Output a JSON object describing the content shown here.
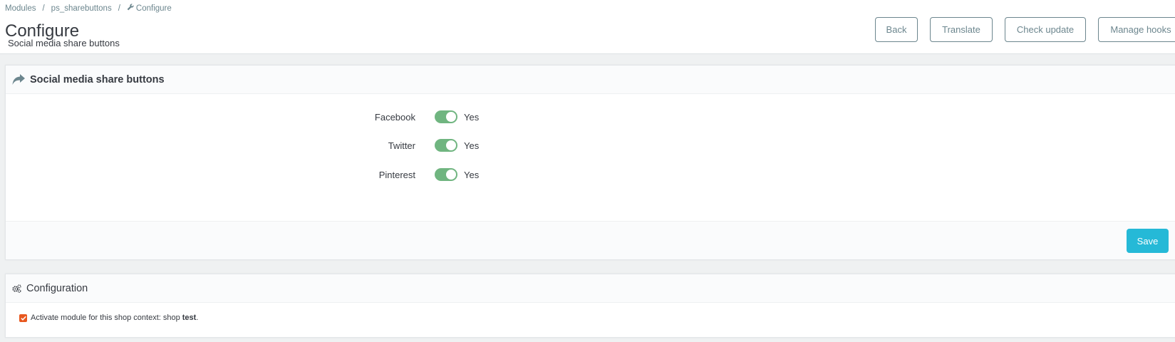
{
  "breadcrumb": {
    "items": [
      "Modules",
      "ps_sharebuttons",
      "Configure"
    ],
    "separator": "/"
  },
  "page": {
    "title": "Configure",
    "subtitle": "Social media share buttons"
  },
  "toolbar": {
    "back_label": "Back",
    "translate_label": "Translate",
    "check_update_label": "Check update",
    "manage_hooks_label": "Manage hooks"
  },
  "share_panel": {
    "heading": "Social media share buttons",
    "icon": "share-icon",
    "fields": [
      {
        "label": "Facebook",
        "value": "Yes",
        "enabled": true
      },
      {
        "label": "Twitter",
        "value": "Yes",
        "enabled": true
      },
      {
        "label": "Pinterest",
        "value": "Yes",
        "enabled": true
      }
    ],
    "save_label": "Save"
  },
  "config_panel": {
    "heading": "Configuration",
    "icon": "cogs-icon",
    "activate_text": "Activate module for this shop context: shop",
    "shop_name": "test",
    "trailing": ".",
    "checked": true
  },
  "colors": {
    "accent": "#25b9d7",
    "switch_on": "#70b580",
    "checkbox": "#e8581f",
    "muted": "#6c868e"
  }
}
